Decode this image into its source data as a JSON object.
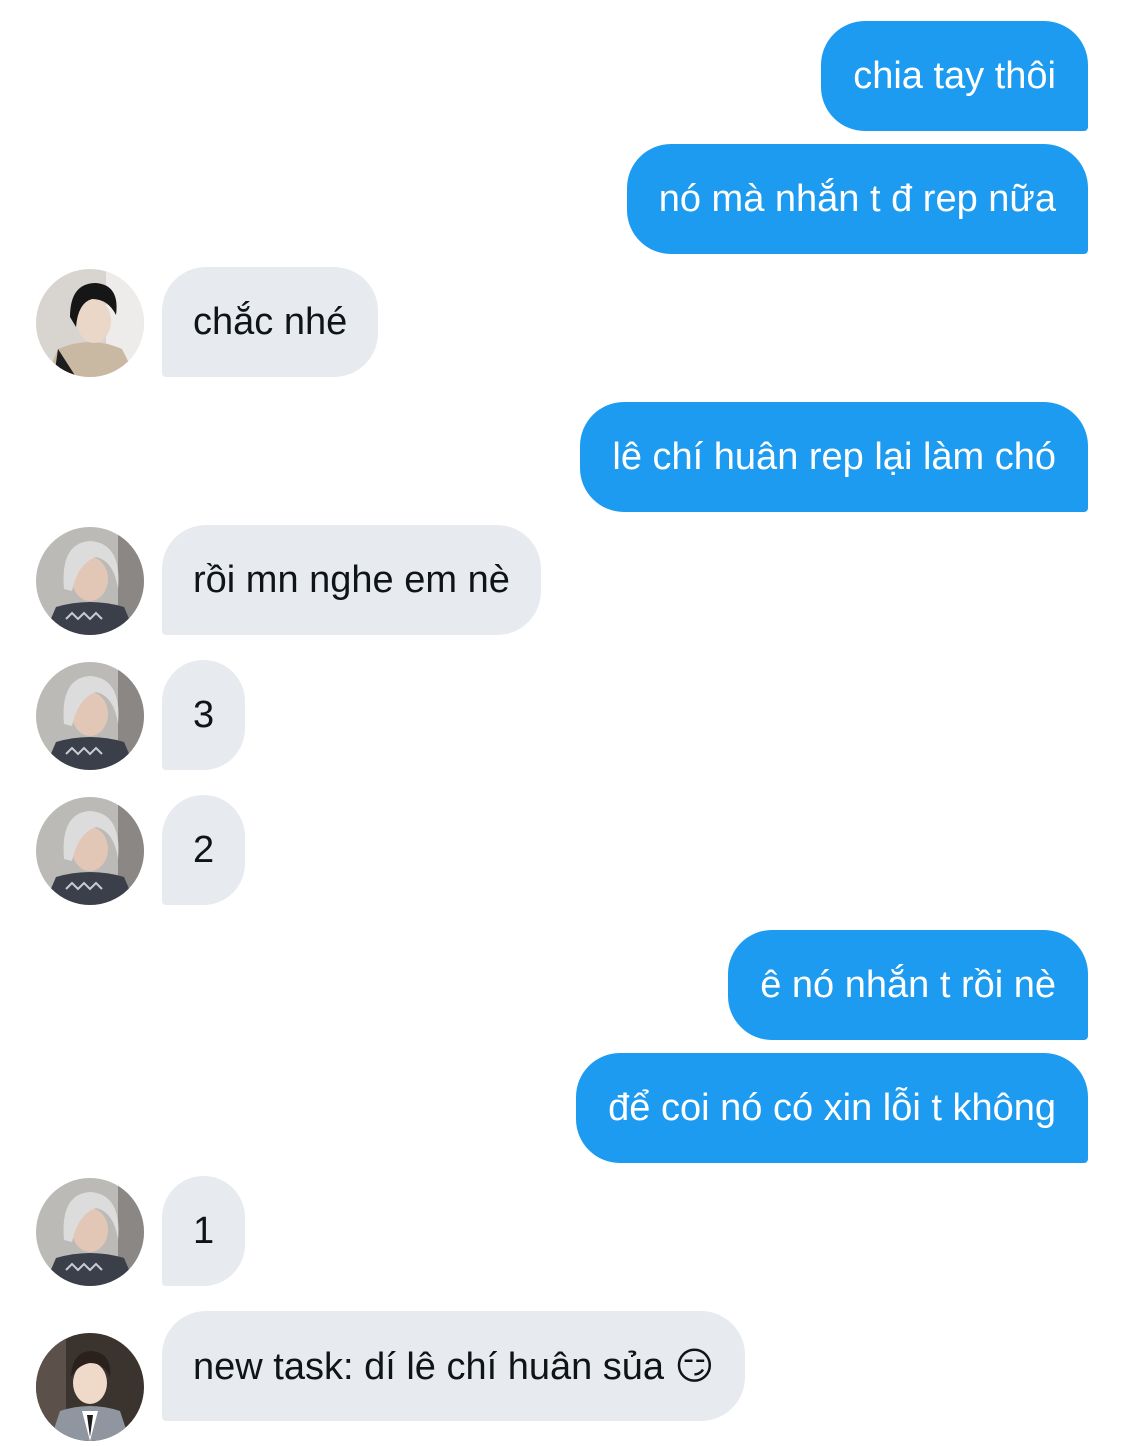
{
  "colors": {
    "outgoing_bubble": "#1d9bf0",
    "incoming_bubble": "#e7eaee",
    "outgoing_text": "#ffffff",
    "incoming_text": "#0f1419"
  },
  "messages": [
    {
      "direction": "outgoing",
      "text": "chia tay thôi"
    },
    {
      "direction": "outgoing",
      "text": "nó mà nhắn t đ rep nữa"
    },
    {
      "direction": "incoming",
      "avatar": "dark-hair-user-avatar",
      "text": "chắc nhé"
    },
    {
      "direction": "outgoing",
      "text": "lê chí huân rep lại làm chó"
    },
    {
      "direction": "incoming",
      "avatar": "silver-hair-user-avatar",
      "text": "rồi mn nghe em nè"
    },
    {
      "direction": "incoming",
      "avatar": "silver-hair-user-avatar",
      "text": "3"
    },
    {
      "direction": "incoming",
      "avatar": "silver-hair-user-avatar",
      "text": "2"
    },
    {
      "direction": "outgoing",
      "text": "ê nó nhắn t rồi nè"
    },
    {
      "direction": "outgoing",
      "text": "để coi nó có xin lỗi t không"
    },
    {
      "direction": "incoming",
      "avatar": "silver-hair-user-avatar",
      "text": "1"
    },
    {
      "direction": "incoming",
      "avatar": "suit-user-avatar",
      "text": "new task: dí lê chí huân sủa",
      "emoji": "😏",
      "emoji_name": "smirking-face-emoji"
    }
  ]
}
